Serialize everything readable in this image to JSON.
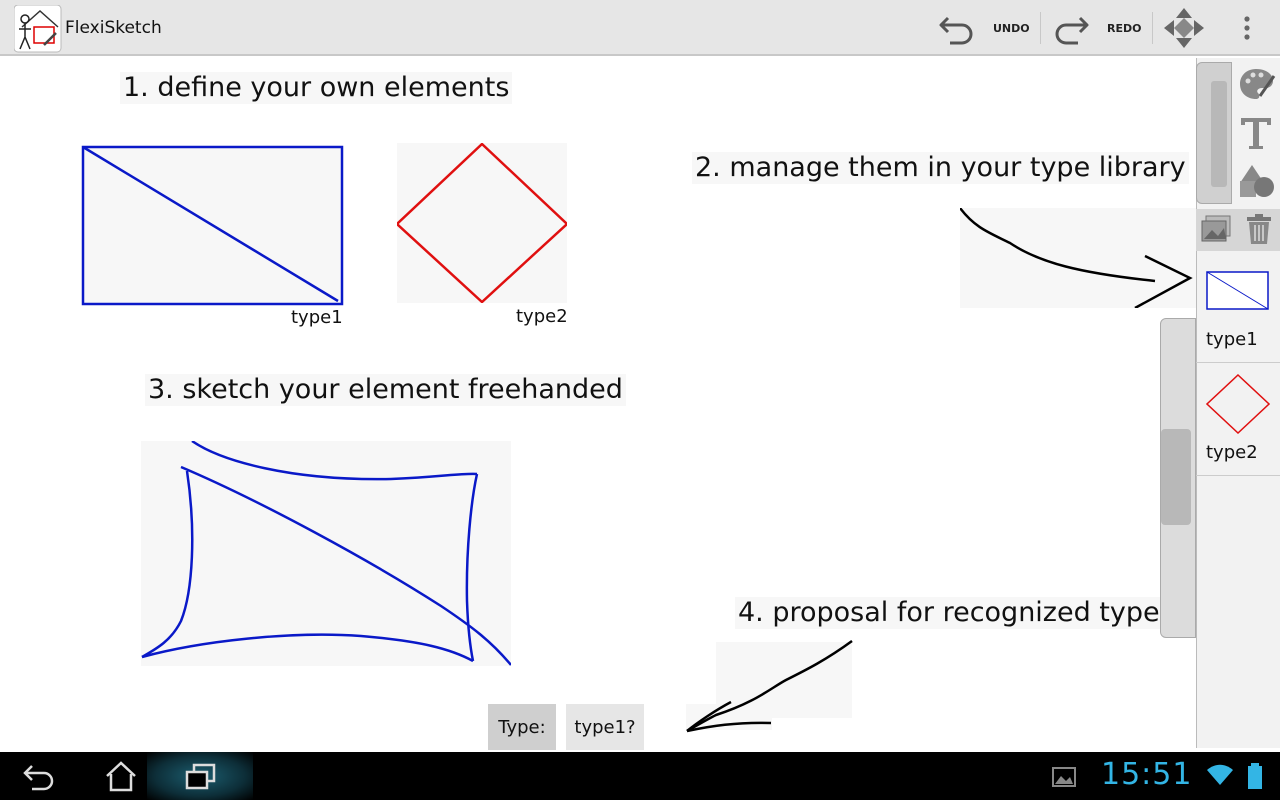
{
  "app": {
    "title": "FlexiSketch"
  },
  "toolbar": {
    "undo_label": "UNDO",
    "redo_label": "REDO"
  },
  "captions": {
    "step1": "1. define your own elements",
    "step2": "2. manage them in your type library",
    "step3": "3. sketch your element freehanded",
    "step4": "4. proposal for recognized type"
  },
  "canvas_labels": {
    "type1": "type1",
    "type2": "type2"
  },
  "library": {
    "items": [
      {
        "label": "type1"
      },
      {
        "label": "type2"
      }
    ]
  },
  "recognition": {
    "prefix": "Type:",
    "proposal": "type1?"
  },
  "status": {
    "time": "15:51"
  },
  "colors": {
    "blue_stroke": "#0a19c8",
    "red_stroke": "#e01010",
    "accent": "#33b5e5"
  }
}
